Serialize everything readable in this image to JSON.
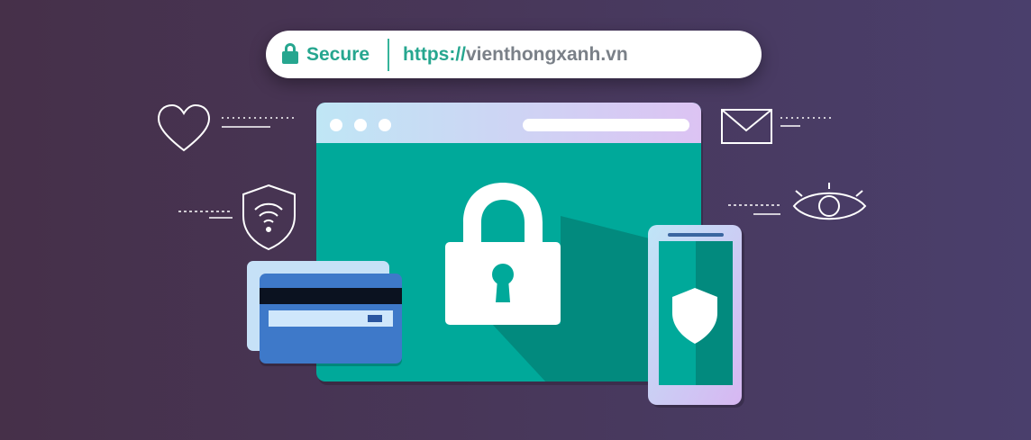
{
  "address_bar": {
    "secure_label": "Secure",
    "scheme": "https://",
    "host": "vienthongxanh.vn"
  },
  "icons": [
    "lock-icon",
    "heart-icon",
    "shield-wifi-icon",
    "envelope-icon",
    "eye-icon",
    "padlock-icon",
    "credit-card-icon",
    "shield-icon"
  ],
  "colors": {
    "accent": "#26a68f",
    "window_body": "#00a99a",
    "background": "#463049",
    "card": "#3e79c9"
  }
}
